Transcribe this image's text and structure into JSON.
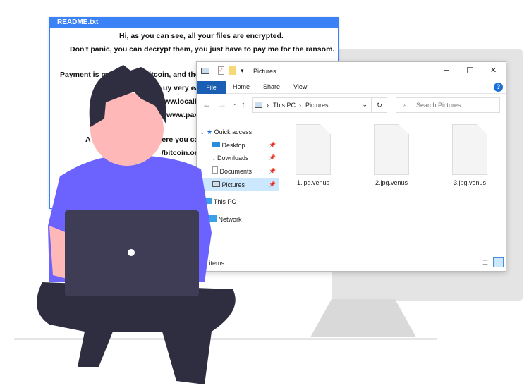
{
  "readme": {
    "title": "README.txt",
    "lines": [
      "Hi, as you can see, all your files are encrypted.",
      "Don't panic, you can decrypt them, you just have to pay me for the ransom.",
      "Payment is ma",
      "bitcoin, and the",
      "uy very eas",
      "ww.localbi",
      "www.pax",
      "A list o",
      "here you ca",
      "/bitcoin.org",
      "re"
    ]
  },
  "explorer": {
    "title": "Pictures",
    "ribbon": {
      "file": "File",
      "tabs": [
        "Home",
        "Share",
        "View"
      ]
    },
    "address": [
      "This PC",
      "Pictures"
    ],
    "search_placeholder": "Search Pictures",
    "nav": [
      "Quick access",
      "Desktop",
      "Downloads",
      "Documents",
      "Pictures",
      "This PC",
      "Network"
    ],
    "files": [
      "1.jpg.venus",
      "2.jpg.venus",
      "3.jpg.venus"
    ],
    "status": "3 items",
    "controls": {
      "minimize": "─",
      "maximize": "☐",
      "close": "✕",
      "help": "?",
      "back": "←",
      "forward": "→",
      "up": "↑",
      "refresh": "↻",
      "chevron": "⌄"
    }
  },
  "colors": {
    "accent": "#3b82f6",
    "file_tab": "#1a5fb4",
    "shirt": "#6c63ff",
    "hair": "#2f2e41",
    "skin": "#ffb8b8",
    "laptop": "#3f3d56"
  }
}
